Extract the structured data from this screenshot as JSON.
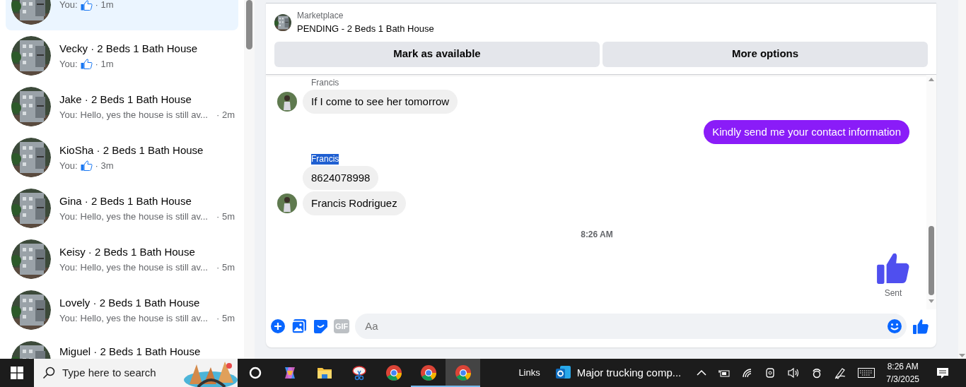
{
  "sidebar": {
    "conversations": [
      {
        "kind": "like",
        "prefix": "You:",
        "time": "· 1m",
        "selected": true
      },
      {
        "kind": "like",
        "title": "Vecky · 2 Beds 1 Bath House",
        "prefix": "You:",
        "time": "· 1m",
        "selected": false
      },
      {
        "kind": "text",
        "title": "Jake · 2 Beds 1 Bath House",
        "prefix": "You:",
        "text": "Hello, yes the house is still av...",
        "time": "· 2m",
        "selected": false
      },
      {
        "kind": "like",
        "title": "KioSha · 2 Beds 1 Bath House",
        "prefix": "You:",
        "time": "· 3m",
        "selected": false
      },
      {
        "kind": "text",
        "title": "Gina · 2 Beds 1 Bath House",
        "prefix": "You:",
        "text": "Hello, yes the house is still av...",
        "time": "· 5m",
        "selected": false
      },
      {
        "kind": "text",
        "title": "Keisy · 2 Beds 1 Bath House",
        "prefix": "You:",
        "text": "Hello, yes the house is still av...",
        "time": "· 5m",
        "selected": false
      },
      {
        "kind": "text",
        "title": "Lovely · 2 Beds 1 Bath House",
        "prefix": "You:",
        "text": "Hello, yes the house is still av...",
        "time": "· 5m",
        "selected": false
      },
      {
        "kind": "cut",
        "title": "Miguel · 2 Beds 1 Bath House",
        "selected": false
      }
    ]
  },
  "chat": {
    "header": {
      "source": "Marketplace",
      "listing": "PENDING - 2 Beds 1 Bath House",
      "buttons": [
        "Mark as available",
        "More options"
      ]
    },
    "messages": [
      {
        "kind": "sender",
        "text": "Francis",
        "highlighted": false
      },
      {
        "kind": "incoming",
        "text": "If I come to see her tomorrow",
        "avatar": true
      },
      {
        "kind": "outgoing",
        "text": "Kindly send me your contact information"
      },
      {
        "kind": "sender",
        "text": "Francis",
        "highlighted": true
      },
      {
        "kind": "incoming",
        "text": "8624078998",
        "avatar": false
      },
      {
        "kind": "incoming",
        "text": "Francis Rodriguez",
        "avatar": true
      },
      {
        "kind": "timestamp",
        "text": "8:26 AM"
      },
      {
        "kind": "like",
        "status": "Sent"
      }
    ],
    "composer": {
      "gif": "GIF",
      "placeholder": "Aa"
    }
  },
  "taskbar": {
    "search_placeholder": "Type here to search",
    "apps": [
      {
        "kind": "cortana",
        "running": false,
        "selected": false
      },
      {
        "kind": "copilot",
        "running": false,
        "selected": false
      },
      {
        "kind": "folder",
        "running": false,
        "selected": false
      },
      {
        "kind": "snip",
        "running": false,
        "selected": false
      },
      {
        "kind": "chrome",
        "running": false,
        "selected": false
      },
      {
        "kind": "chrome",
        "running": true,
        "selected": false
      },
      {
        "kind": "chrome",
        "running": true,
        "selected": true
      }
    ],
    "links": "Links",
    "window_title": "Major trucking comp...",
    "time": "8:26 AM",
    "date": "7/3/2025"
  }
}
